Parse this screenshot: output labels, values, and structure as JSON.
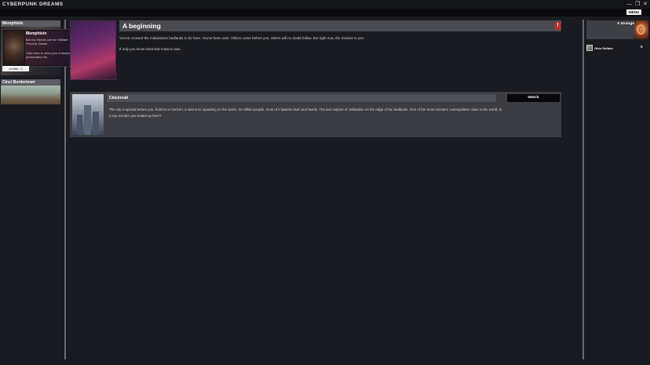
{
  "app": {
    "title": "CYBERPUNK DREAMS",
    "menu_label": "MENU",
    "window_controls": {
      "minimize": "—",
      "restore": "❐",
      "close": "✕"
    }
  },
  "left_panel": {
    "locations": [
      {
        "name": "Memphisto",
        "icon": "location-image"
      },
      {
        "name": "Cinci Bordertown",
        "icon": "location-image"
      }
    ],
    "character_card": {
      "name": "Memphisto",
      "line1": "But my friends call me William",
      "line2": "Percival Dawat.",
      "line3": "Click here to view your character's",
      "line4": "personality info.",
      "credits_label": "credits : 0"
    }
  },
  "story": {
    "title": "A beginning",
    "warning_icon": "!",
    "paragraph1": "You've crossed the midwestern badlands to be here. You've been sent. Others came before you; others will no doubt follow. But right now, the mission is you.",
    "paragraph2": "If only you know what that mission was."
  },
  "choice": {
    "name": "Cincinnati",
    "description": "The city is spread before you, horizon to horizon, a vast sore squatting on the world. 34 million people, most of it lawless slum and favela. The last outpost of civilisation on the edge of the badlands. One of the most relevant, cosmopolitan cities in the world. Is it any wonder you ended up here?",
    "watch_label": "Watch"
  },
  "right_panel": {
    "character_name": "A stranger",
    "inventory": [
      {
        "name": "Ohio Dollars",
        "count": "0",
        "icon": "currency-icon"
      }
    ]
  },
  "colors": {
    "background": "#1a1b20",
    "panel": "#3c3d42",
    "warning": "#c52b25"
  }
}
